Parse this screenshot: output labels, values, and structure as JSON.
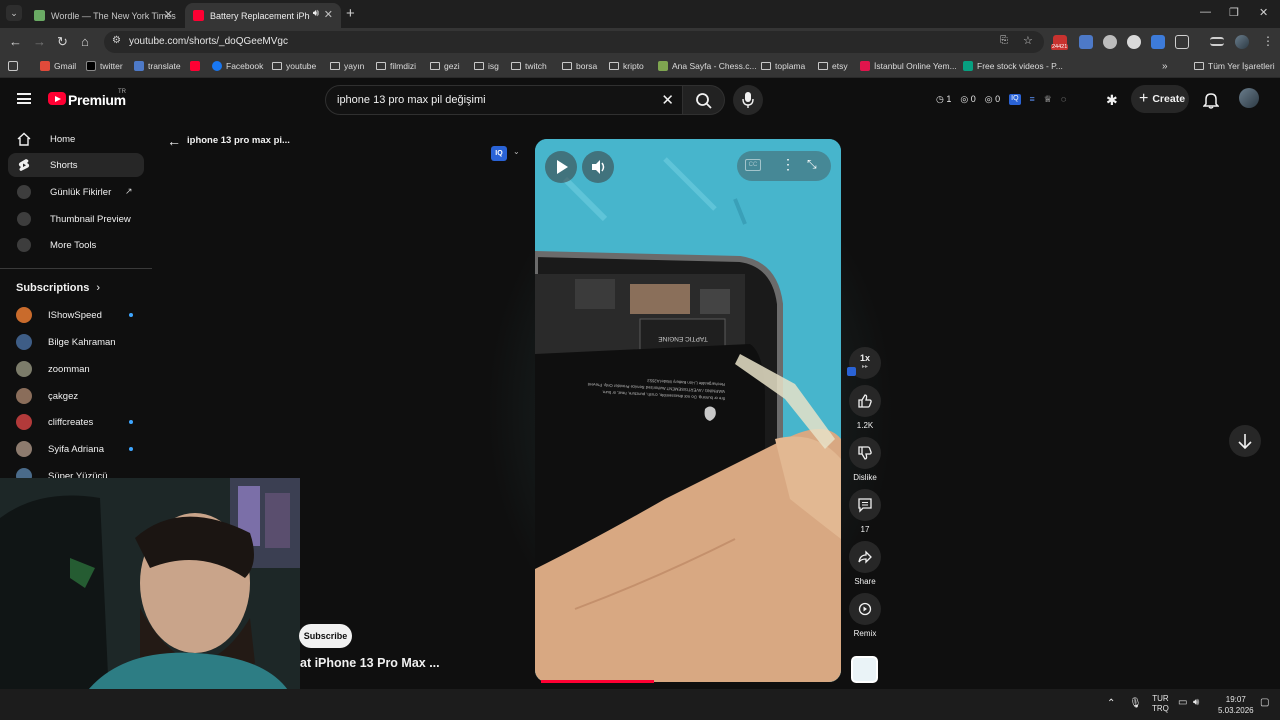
{
  "browser": {
    "tabs": [
      {
        "title": "Wordle — The New York Times",
        "active": false,
        "favicon_color": "#6aaa64"
      },
      {
        "title": "Battery Replacement iPhone",
        "active": true,
        "favicon_color": "#ff0033"
      }
    ],
    "url": "youtube.com/shorts/_doQGeeMVgc",
    "extension_badge": "24421",
    "bookmarks": [
      {
        "label": "Gmail",
        "icon": "gmail-icon"
      },
      {
        "label": "twitter",
        "icon": "x-icon"
      },
      {
        "label": "translate",
        "icon": "translate-icon"
      },
      {
        "label": "",
        "icon": "youtube-icon"
      },
      {
        "label": "Facebook",
        "icon": "facebook-icon"
      },
      {
        "label": "youtube",
        "icon": "folder-icon"
      },
      {
        "label": "yayın",
        "icon": "folder-icon"
      },
      {
        "label": "filmdizi",
        "icon": "folder-icon"
      },
      {
        "label": "gezi",
        "icon": "folder-icon"
      },
      {
        "label": "isg",
        "icon": "folder-icon"
      },
      {
        "label": "twitch",
        "icon": "folder-icon"
      },
      {
        "label": "borsa",
        "icon": "folder-icon"
      },
      {
        "label": "kripto",
        "icon": "folder-icon"
      },
      {
        "label": "Ana Sayfa - Chess.c...",
        "icon": "chess-icon"
      },
      {
        "label": "toplama",
        "icon": "folder-icon"
      },
      {
        "label": "etsy",
        "icon": "folder-icon"
      },
      {
        "label": "İstanbul Online Yem...",
        "icon": "yemeksepeti-icon"
      },
      {
        "label": "Free stock videos - P...",
        "icon": "pexels-icon"
      }
    ],
    "all_bookmarks": "Tüm Yer İşaretleri"
  },
  "youtube": {
    "logo_text": "Premium",
    "region": "TR",
    "search_query": "iphone 13 pro max pil değişimi",
    "counters": [
      "1",
      "0",
      "0"
    ],
    "create_label": "Create",
    "sidebar": {
      "items": [
        {
          "label": "Home",
          "icon": "home-icon",
          "selected": false
        },
        {
          "label": "Shorts",
          "icon": "shorts-icon",
          "selected": true
        },
        {
          "label": "Günlük Fikirler",
          "icon": "extension-icon",
          "selected": false
        },
        {
          "label": "Thumbnail Preview",
          "icon": "extension-icon",
          "selected": false
        },
        {
          "label": "More Tools",
          "icon": "extension-icon",
          "selected": false
        }
      ],
      "subscriptions_heading": "Subscriptions",
      "subscriptions": [
        {
          "name": "IShowSpeed",
          "new": true,
          "color": "#c96b2c"
        },
        {
          "name": "Bilge Kahraman",
          "new": false,
          "color": "#3e5d86"
        },
        {
          "name": "zoomman",
          "new": false,
          "color": "#7c7c6a"
        },
        {
          "name": "çakgez",
          "new": false,
          "color": "#8a6d5a"
        },
        {
          "name": "cliffcreates",
          "new": true,
          "color": "#b23a3a"
        },
        {
          "name": "Syifa Adriana",
          "new": true,
          "color": "#8d7b6e"
        },
        {
          "name": "Süper Yüzücü",
          "new": false,
          "color": "#4a6b8a"
        }
      ]
    },
    "back_label": "iphone 13 pro max pi...",
    "short": {
      "title": "at iPhone 13 Pro Max ...",
      "subscribe_label": "Subscribe",
      "progress": 0.37,
      "speed_label": "1x",
      "actions": [
        {
          "icon": "like-icon",
          "label": "1.2K"
        },
        {
          "icon": "dislike-icon",
          "label": "Dislike"
        },
        {
          "icon": "comment-icon",
          "label": "17"
        },
        {
          "icon": "share-icon",
          "label": "Share"
        },
        {
          "icon": "remix-icon",
          "label": "Remix"
        }
      ],
      "video_text": {
        "module": "TAPTIC ENGINE",
        "battery_lines": [
          "Rechargeable Li-ion Battery Model A2653",
          "WARNING / AVERTISSEMENT Authorized Service Provider Only. Prevent",
          "fire or burning. Do not disassemble, crush, puncture, heat, or burn."
        ]
      }
    }
  },
  "taskbar": {
    "lang_top": "TUR",
    "lang_bottom": "TRQ",
    "time": "19:07",
    "date": "5.03.2026"
  },
  "colors": {
    "youtube_red": "#ff0033",
    "accent_blue": "#3ea6ff",
    "background": "#0f0f0f"
  }
}
